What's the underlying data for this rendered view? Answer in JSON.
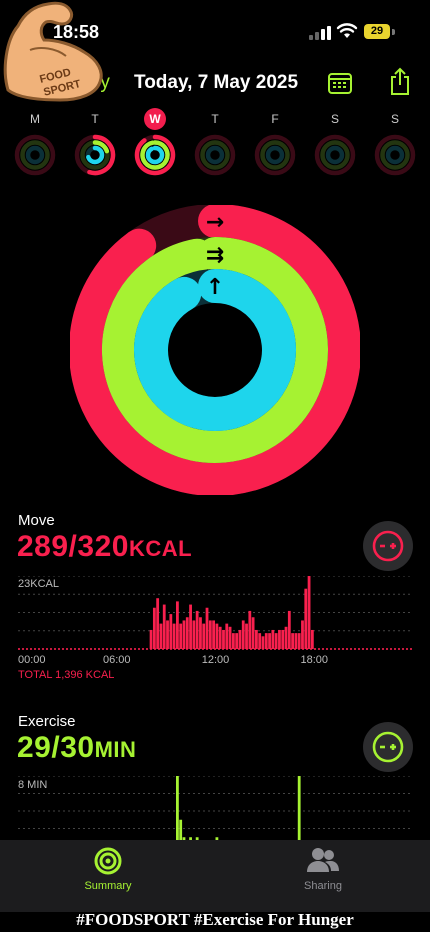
{
  "status": {
    "time": "18:58",
    "battery": "29"
  },
  "header": {
    "back_label": "ry",
    "title": "Today, 7 May 2025"
  },
  "week": [
    {
      "label": "M",
      "selected": false,
      "move": 0.0,
      "exercise": 0.0,
      "stand": 0.0
    },
    {
      "label": "T",
      "selected": false,
      "move": 0.55,
      "exercise": 0.2,
      "stand": 0.7
    },
    {
      "label": "W",
      "selected": true,
      "move": 0.9,
      "exercise": 0.97,
      "stand": 0.92
    },
    {
      "label": "T",
      "selected": false,
      "move": 0,
      "exercise": 0,
      "stand": 0
    },
    {
      "label": "F",
      "selected": false,
      "move": 0,
      "exercise": 0,
      "stand": 0
    },
    {
      "label": "S",
      "selected": false,
      "move": 0,
      "exercise": 0,
      "stand": 0
    },
    {
      "label": "S",
      "selected": false,
      "move": 0,
      "exercise": 0,
      "stand": 0
    }
  ],
  "rings": {
    "move": 0.9,
    "exercise": 0.97,
    "stand": 0.92
  },
  "move": {
    "label": "Move",
    "value": "289/320",
    "unit": "KCAL",
    "chart_max_label": "23KCAL",
    "total": "TOTAL 1,396 KCAL",
    "color": "#f9204e"
  },
  "exercise": {
    "label": "Exercise",
    "value": "29/30",
    "unit": "MIN",
    "chart_max_label": "8 MIN",
    "color": "#a6f232"
  },
  "chart_data": [
    {
      "type": "bar",
      "title": "Move",
      "xlabel": "",
      "ylabel": "",
      "x_ticks": [
        "00:00",
        "06:00",
        "12:00",
        "18:00"
      ],
      "ylim": [
        0,
        23
      ],
      "x_range_hours": [
        0,
        24
      ],
      "series": [
        {
          "name": "Move",
          "x": [
            8.0,
            8.2,
            8.4,
            8.6,
            8.8,
            9.0,
            9.2,
            9.4,
            9.6,
            9.8,
            10.0,
            10.2,
            10.4,
            10.6,
            10.8,
            11.0,
            11.2,
            11.4,
            11.6,
            11.8,
            12.0,
            12.2,
            12.4,
            12.6,
            12.8,
            13.0,
            13.2,
            13.4,
            13.6,
            13.8,
            14.0,
            14.2,
            14.4,
            14.6,
            14.8,
            15.0,
            15.2,
            15.4,
            15.6,
            15.8,
            16.0,
            16.2,
            16.4,
            16.6,
            16.8,
            17.0,
            17.2,
            17.4,
            17.6,
            17.8
          ],
          "values": [
            6,
            13,
            16,
            8,
            14,
            9,
            11,
            8,
            15,
            8,
            9,
            10,
            14,
            9,
            12,
            10,
            8,
            13,
            9,
            9,
            8,
            7,
            6,
            8,
            7,
            5,
            5,
            6,
            9,
            8,
            12,
            10,
            6,
            5,
            4,
            5,
            5,
            6,
            5,
            6,
            6,
            7,
            12,
            5,
            5,
            5,
            9,
            19,
            23,
            6
          ]
        }
      ]
    },
    {
      "type": "bar",
      "title": "Exercise",
      "xlabel": "",
      "ylabel": "",
      "ylim": [
        0,
        8
      ],
      "x_range_hours": [
        0,
        24
      ],
      "series": [
        {
          "name": "Exercise",
          "x": [
            9.6,
            9.8,
            10.0,
            10.4,
            10.8,
            12.0,
            17.0
          ],
          "values": [
            8,
            3,
            1,
            1,
            1,
            1,
            8
          ]
        }
      ]
    }
  ],
  "tabs": [
    {
      "label": "Summary",
      "active": true
    },
    {
      "label": "Sharing",
      "active": false
    }
  ],
  "caption": "#FOODSPORT #Exercise For Hunger",
  "logo_text": [
    "FOOD",
    "SPORT"
  ]
}
